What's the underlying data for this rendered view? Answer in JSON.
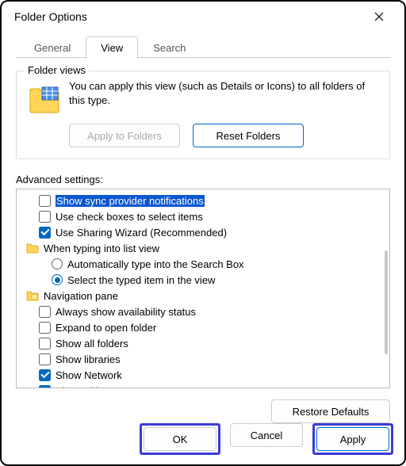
{
  "window": {
    "title": "Folder Options"
  },
  "tabs": {
    "general": "General",
    "view": "View",
    "search": "Search",
    "active": "view"
  },
  "folder_views": {
    "legend": "Folder views",
    "description": "You can apply this view (such as Details or Icons) to all folders of this type.",
    "apply_btn": "Apply to Folders",
    "reset_btn": "Reset Folders"
  },
  "advanced": {
    "label": "Advanced settings:",
    "items": [
      {
        "kind": "checkbox",
        "checked": false,
        "label": "Show sync provider notifications",
        "highlight": true
      },
      {
        "kind": "checkbox",
        "checked": false,
        "label": "Use check boxes to select items"
      },
      {
        "kind": "checkbox",
        "checked": true,
        "label": "Use Sharing Wizard (Recommended)"
      },
      {
        "kind": "group-folder",
        "label": "When typing into list view"
      },
      {
        "kind": "radio",
        "checked": false,
        "label": "Automatically type into the Search Box",
        "sub": true
      },
      {
        "kind": "radio",
        "checked": true,
        "label": "Select the typed item in the view",
        "sub": true
      },
      {
        "kind": "group-nav",
        "label": "Navigation pane"
      },
      {
        "kind": "checkbox",
        "checked": false,
        "label": "Always show availability status"
      },
      {
        "kind": "checkbox",
        "checked": false,
        "label": "Expand to open folder"
      },
      {
        "kind": "checkbox",
        "checked": false,
        "label": "Show all folders"
      },
      {
        "kind": "checkbox",
        "checked": false,
        "label": "Show libraries"
      },
      {
        "kind": "checkbox",
        "checked": true,
        "label": "Show Network"
      },
      {
        "kind": "checkbox",
        "checked": true,
        "label": "Show This PC"
      }
    ]
  },
  "buttons": {
    "restore": "Restore Defaults",
    "ok": "OK",
    "cancel": "Cancel",
    "apply": "Apply"
  }
}
